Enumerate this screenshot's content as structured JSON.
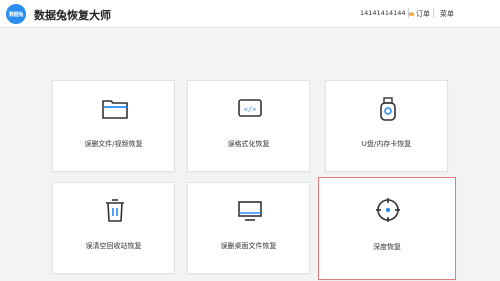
{
  "app": {
    "logo_text": "数据兔",
    "title": "数据兔恢复大师"
  },
  "header": {
    "account_number": "14141414144",
    "vip_icon": "crown-icon",
    "order_label": "订单",
    "menu_label": "菜单"
  },
  "cards": [
    {
      "label": "误删文件/视频恢复",
      "icon": "folder-icon"
    },
    {
      "label": "误格式化恢复",
      "icon": "code-window-icon"
    },
    {
      "label": "U盘/内存卡恢复",
      "icon": "usb-drive-icon"
    },
    {
      "label": "误清空回收站恢复",
      "icon": "trash-icon"
    },
    {
      "label": "误删桌面文件恢复",
      "icon": "monitor-icon"
    },
    {
      "label": "深度恢复",
      "icon": "target-icon"
    }
  ],
  "colors": {
    "accent": "#2a8df0",
    "selected_border": "#e07a7a",
    "vip": "#f5a623"
  }
}
